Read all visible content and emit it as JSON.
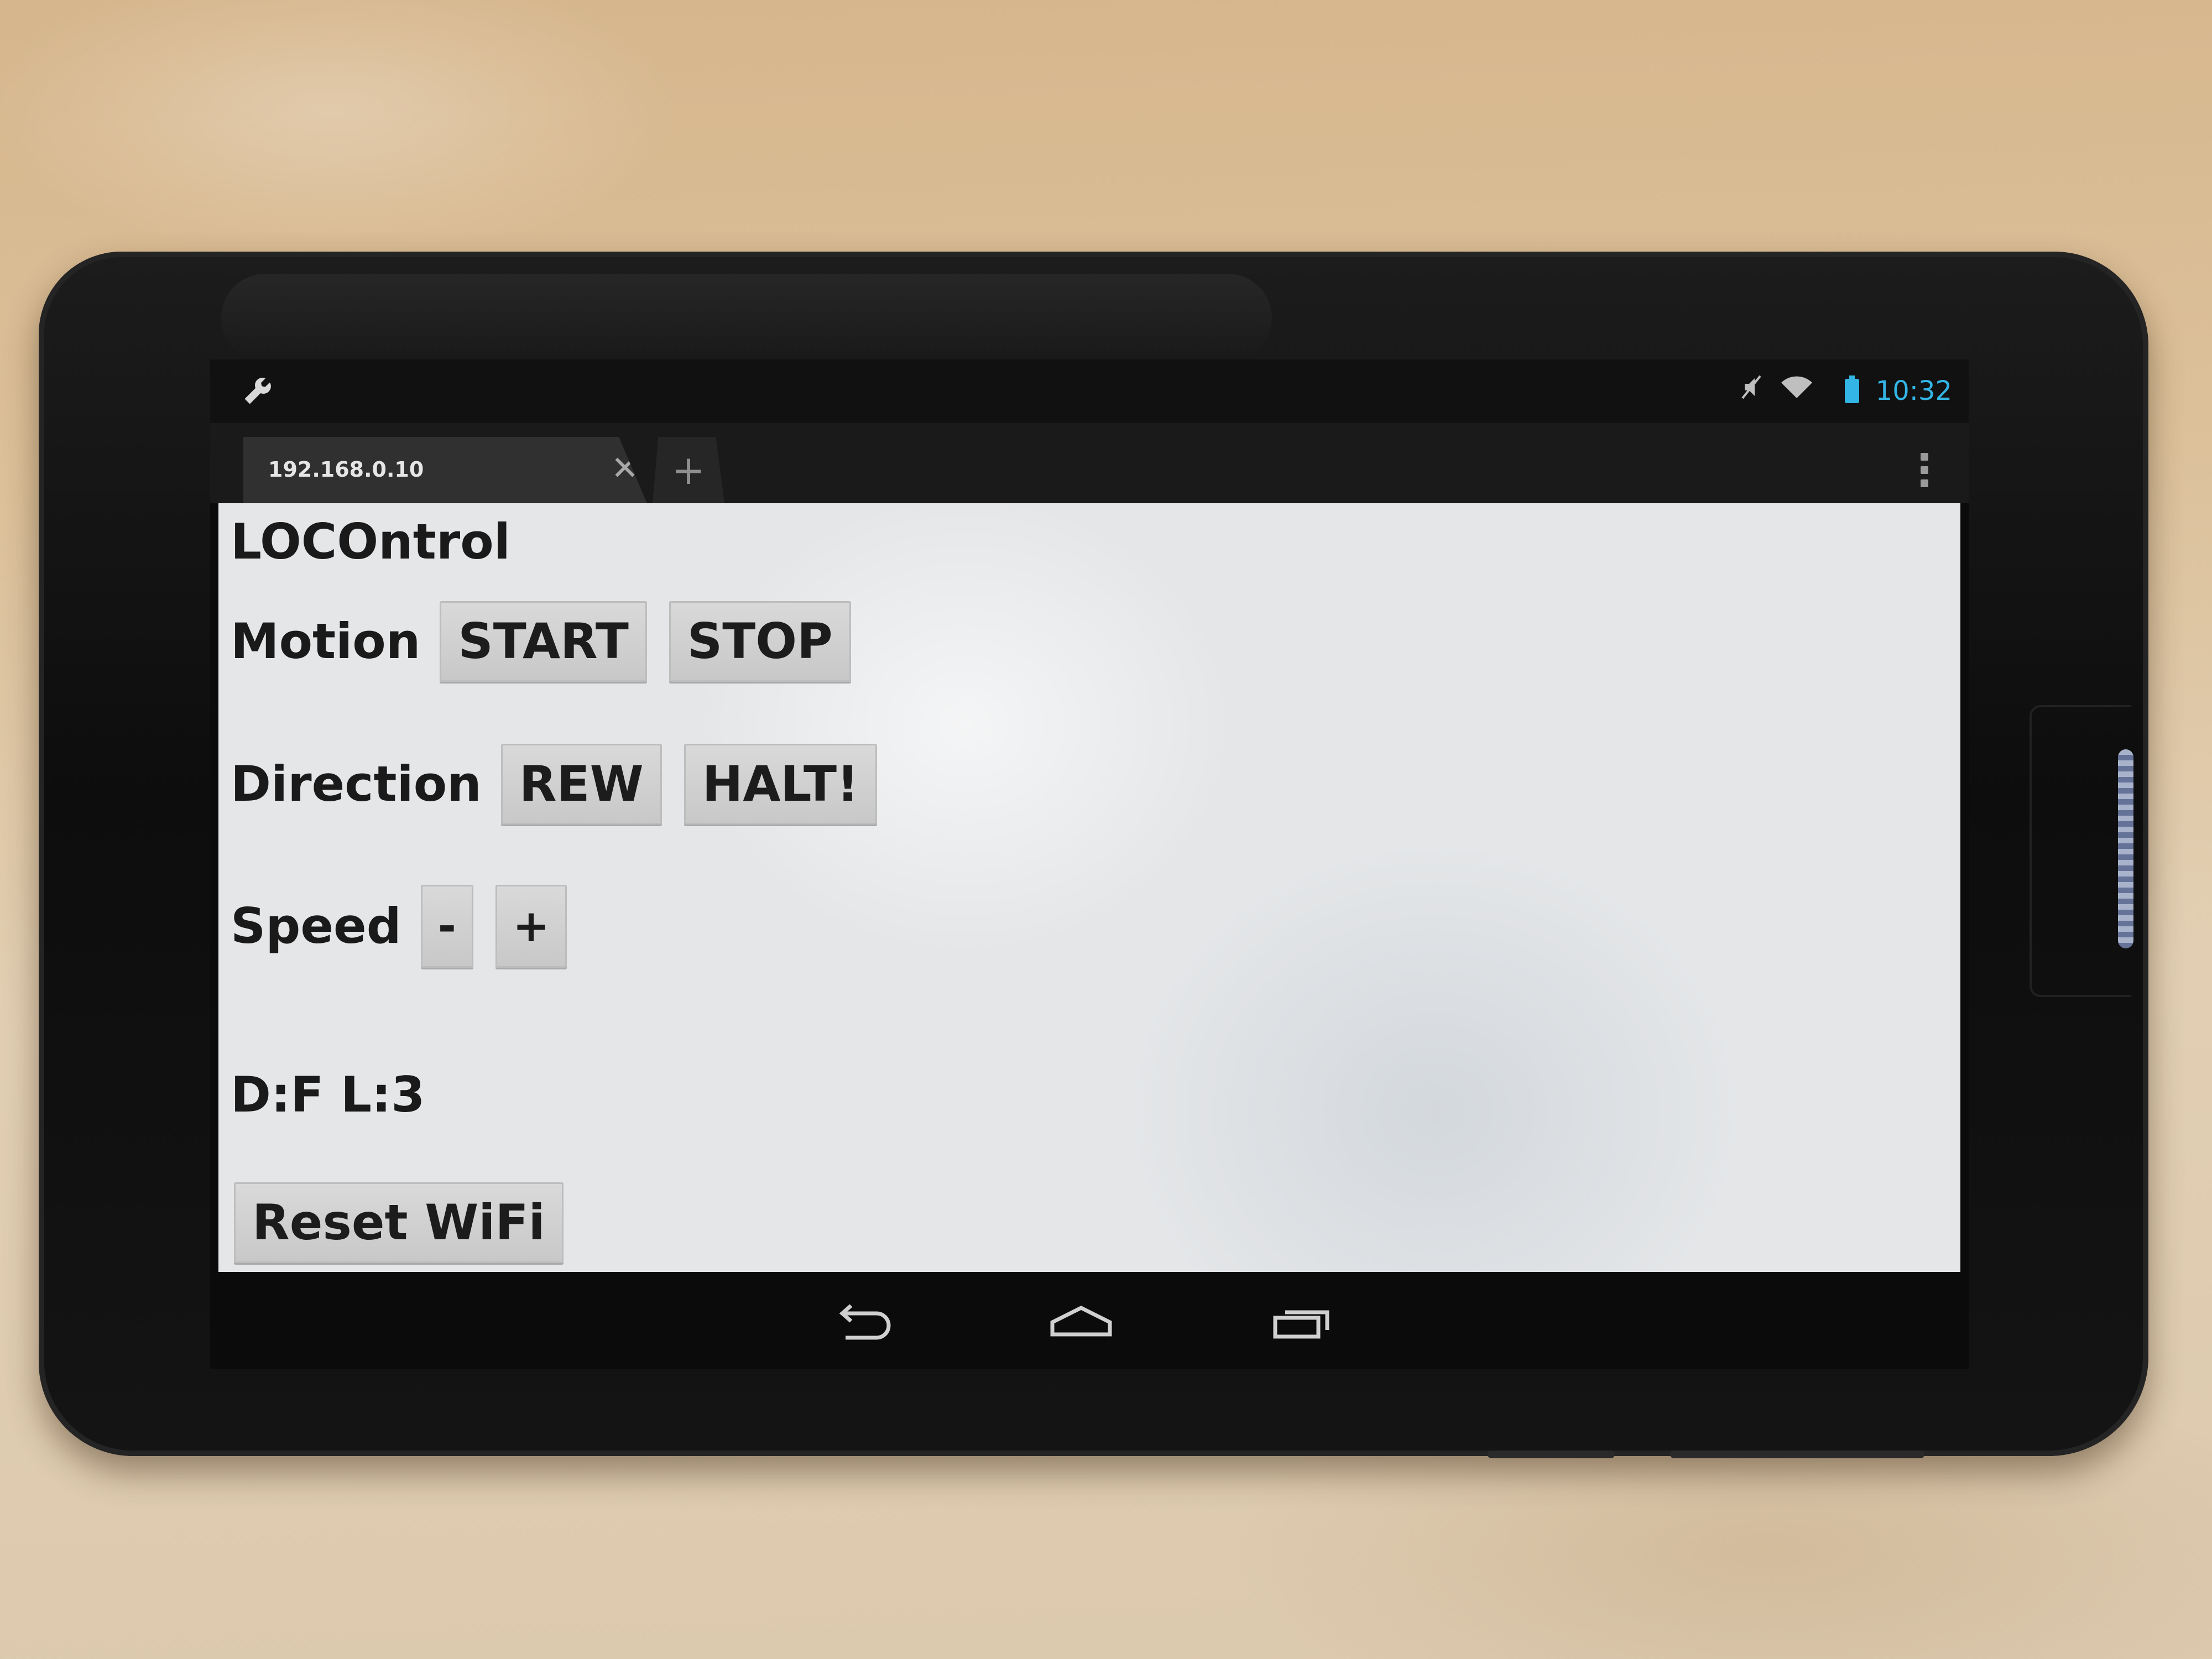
{
  "status_bar": {
    "time": "10:32",
    "icons": [
      "wrench-icon",
      "mute-icon",
      "wifi-icon",
      "battery-icon"
    ],
    "accent_color": "#33b5e5"
  },
  "browser": {
    "tab_title": "192.168.0.10",
    "tab_close_glyph": "✕",
    "new_tab_glyph": "+"
  },
  "page": {
    "title": "LOCOntrol",
    "motion": {
      "label": "Motion",
      "start_label": "START",
      "stop_label": "STOP"
    },
    "direction": {
      "label": "Direction",
      "rew_label": "REW",
      "halt_label": "HALT!"
    },
    "speed": {
      "label": "Speed",
      "minus_label": "-",
      "plus_label": "+"
    },
    "status_text": "D:F L:3",
    "reset_label": "Reset WiFi"
  },
  "nav_bar": {
    "icons": [
      "back-icon",
      "home-icon",
      "recent-apps-icon"
    ]
  }
}
